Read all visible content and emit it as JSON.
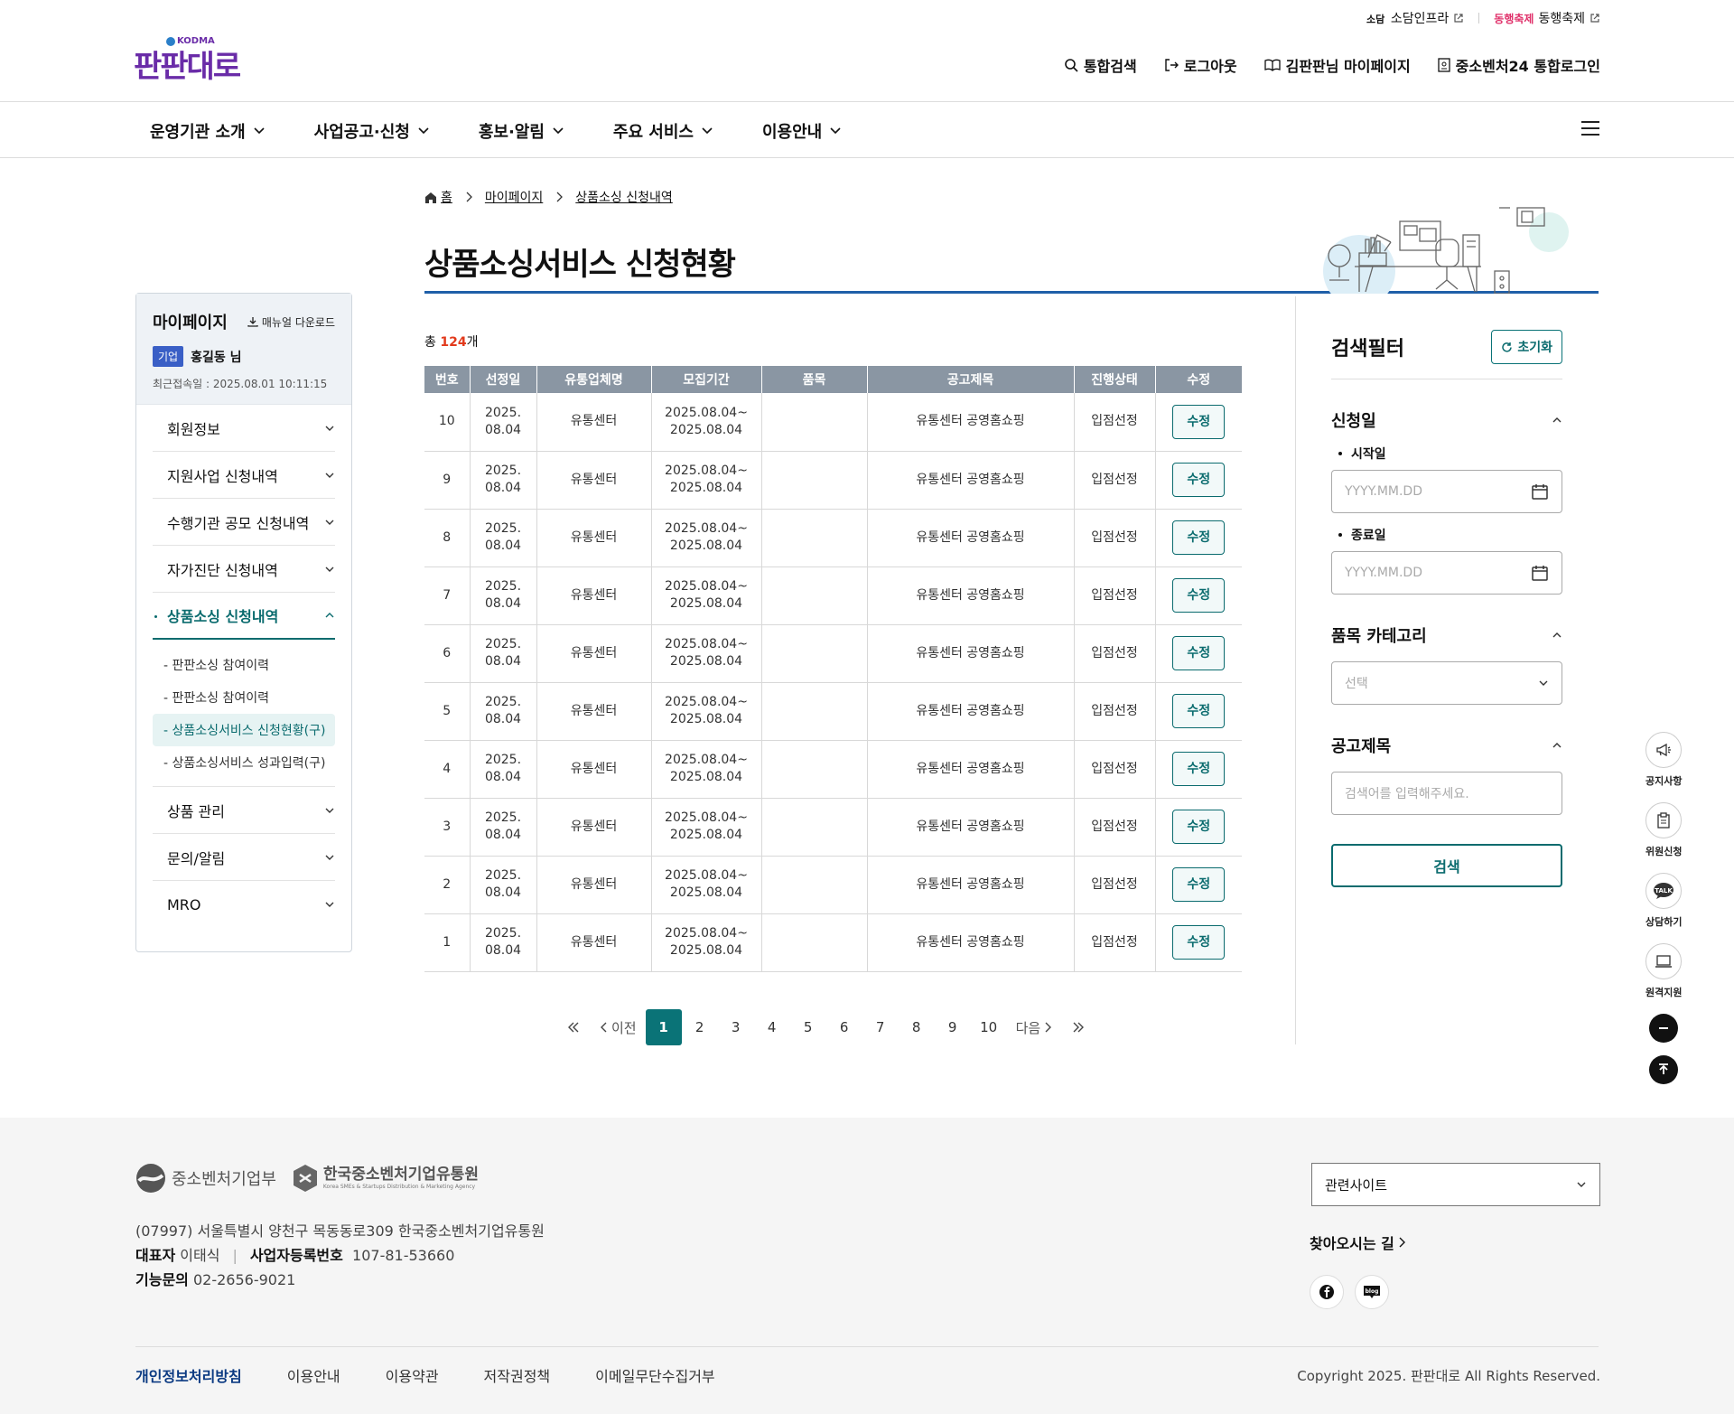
{
  "util": {
    "link1": "소담인프라",
    "link2": "동행축제",
    "link2_logo": "동행축제"
  },
  "logo": {
    "korean": "판판대로",
    "kodma": "KODMA"
  },
  "topnav": [
    "통합검색",
    "로그아웃",
    "김판판님 마이페이지",
    "중소벤처24 통합로그인"
  ],
  "gnb": [
    "운영기관 소개",
    "사업공고·신청",
    "홍보·알림",
    "주요 서비스",
    "이용안내"
  ],
  "breadcrumb": {
    "home": "홈",
    "b1": "마이페이지",
    "b2": "상품소싱 신청내역"
  },
  "page_title": "상품소싱서비스 신청현황",
  "sidebar": {
    "title": "마이페이지",
    "manual": "매뉴얼 다운로드",
    "badge": "기업",
    "user": "홍길동 님",
    "last_login": "최근접속일 : 2025.08.01 10:11:15",
    "menu": [
      "회원정보",
      "지원사업 신청내역",
      "수행기관 공모 신청내역",
      "자가진단 신청내역",
      "상품소싱 신청내역"
    ],
    "sub": [
      "- 판판소싱 참여이력",
      "- 판판소싱 참여이력",
      "- 상품소싱서비스 신청현황(구)",
      "- 상품소싱서비스 성과입력(구)"
    ],
    "menu2": [
      "상품 관리",
      "문의/알림",
      "MRO"
    ]
  },
  "total": {
    "prefix": "총 ",
    "count": "124",
    "suffix": "개"
  },
  "table": {
    "headers": [
      "번호",
      "선정일",
      "유통업체명",
      "모집기간",
      "품목",
      "공고제목",
      "진행상태",
      "수정"
    ],
    "rows": [
      {
        "no": "10",
        "date1": "2025.",
        "date2": "08.04",
        "company": "유통센터",
        "p1": "2025.08.04~",
        "p2": "2025.08.04",
        "item": "",
        "title": "유통센터 공영홈쇼핑",
        "status": "입점선정",
        "edit": "수정"
      },
      {
        "no": "9",
        "date1": "2025.",
        "date2": "08.04",
        "company": "유통센터",
        "p1": "2025.08.04~",
        "p2": "2025.08.04",
        "item": "",
        "title": "유통센터 공영홈쇼핑",
        "status": "입점선정",
        "edit": "수정"
      },
      {
        "no": "8",
        "date1": "2025.",
        "date2": "08.04",
        "company": "유통센터",
        "p1": "2025.08.04~",
        "p2": "2025.08.04",
        "item": "",
        "title": "유통센터 공영홈쇼핑",
        "status": "입점선정",
        "edit": "수정"
      },
      {
        "no": "7",
        "date1": "2025.",
        "date2": "08.04",
        "company": "유통센터",
        "p1": "2025.08.04~",
        "p2": "2025.08.04",
        "item": "",
        "title": "유통센터 공영홈쇼핑",
        "status": "입점선정",
        "edit": "수정"
      },
      {
        "no": "6",
        "date1": "2025.",
        "date2": "08.04",
        "company": "유통센터",
        "p1": "2025.08.04~",
        "p2": "2025.08.04",
        "item": "",
        "title": "유통센터 공영홈쇼핑",
        "status": "입점선정",
        "edit": "수정"
      },
      {
        "no": "5",
        "date1": "2025.",
        "date2": "08.04",
        "company": "유통센터",
        "p1": "2025.08.04~",
        "p2": "2025.08.04",
        "item": "",
        "title": "유통센터 공영홈쇼핑",
        "status": "입점선정",
        "edit": "수정"
      },
      {
        "no": "4",
        "date1": "2025.",
        "date2": "08.04",
        "company": "유통센터",
        "p1": "2025.08.04~",
        "p2": "2025.08.04",
        "item": "",
        "title": "유통센터 공영홈쇼핑",
        "status": "입점선정",
        "edit": "수정"
      },
      {
        "no": "3",
        "date1": "2025.",
        "date2": "08.04",
        "company": "유통센터",
        "p1": "2025.08.04~",
        "p2": "2025.08.04",
        "item": "",
        "title": "유통센터 공영홈쇼핑",
        "status": "입점선정",
        "edit": "수정"
      },
      {
        "no": "2",
        "date1": "2025.",
        "date2": "08.04",
        "company": "유통센터",
        "p1": "2025.08.04~",
        "p2": "2025.08.04",
        "item": "",
        "title": "유통센터 공영홈쇼핑",
        "status": "입점선정",
        "edit": "수정"
      },
      {
        "no": "1",
        "date1": "2025.",
        "date2": "08.04",
        "company": "유통센터",
        "p1": "2025.08.04~",
        "p2": "2025.08.04",
        "item": "",
        "title": "유통센터 공영홈쇼핑",
        "status": "입점선정",
        "edit": "수정"
      }
    ]
  },
  "pager": {
    "prev": "이전",
    "next": "다음",
    "pages": [
      "1",
      "2",
      "3",
      "4",
      "5",
      "6",
      "7",
      "8",
      "9",
      "10"
    ],
    "current": "1"
  },
  "filter": {
    "title": "검색필터",
    "reset": "초기화",
    "s1": "신청일",
    "start_label": "시작일",
    "end_label": "종료일",
    "date_placeholder": "YYYY.MM.DD",
    "s2": "품목 카테고리",
    "select": "선택",
    "s3": "공고제목",
    "keyword_placeholder": "검색어를 입력해주세요.",
    "search": "검색"
  },
  "quick": [
    "공지사항",
    "위원신청",
    "상담하기",
    "원격지원"
  ],
  "quick_talk": "TALK",
  "footer": {
    "logo1": "중소벤처기업부",
    "logo2": "한국중소벤처기업유통원",
    "logo2_en": "Korea SMEs & Startups Distribution & Marketing Agency",
    "address": "(07997) 서울특별시 양천구 목동동로309 한국중소벤처기업유통원",
    "ceo_label": "대표자",
    "ceo": "이태식",
    "biz_label": "사업자등록번호",
    "biz": "107-81-53660",
    "inq_label": "기능문의",
    "inq": "02-2656-9021",
    "related": "관련사이트",
    "directions": "찾아오시는 길",
    "blog": "blog",
    "links": [
      "개인정보처리방침",
      "이용안내",
      "이용약관",
      "저작권정책",
      "이메일무단수집거부"
    ],
    "copyright": "Copyright 2025. 판판대로 All Rights Reserved."
  },
  "colors": {
    "primary": "#0a7377",
    "title_line": "#1f5fa8",
    "total_count": "#e23a1c",
    "logo": "#6a2ca8"
  }
}
